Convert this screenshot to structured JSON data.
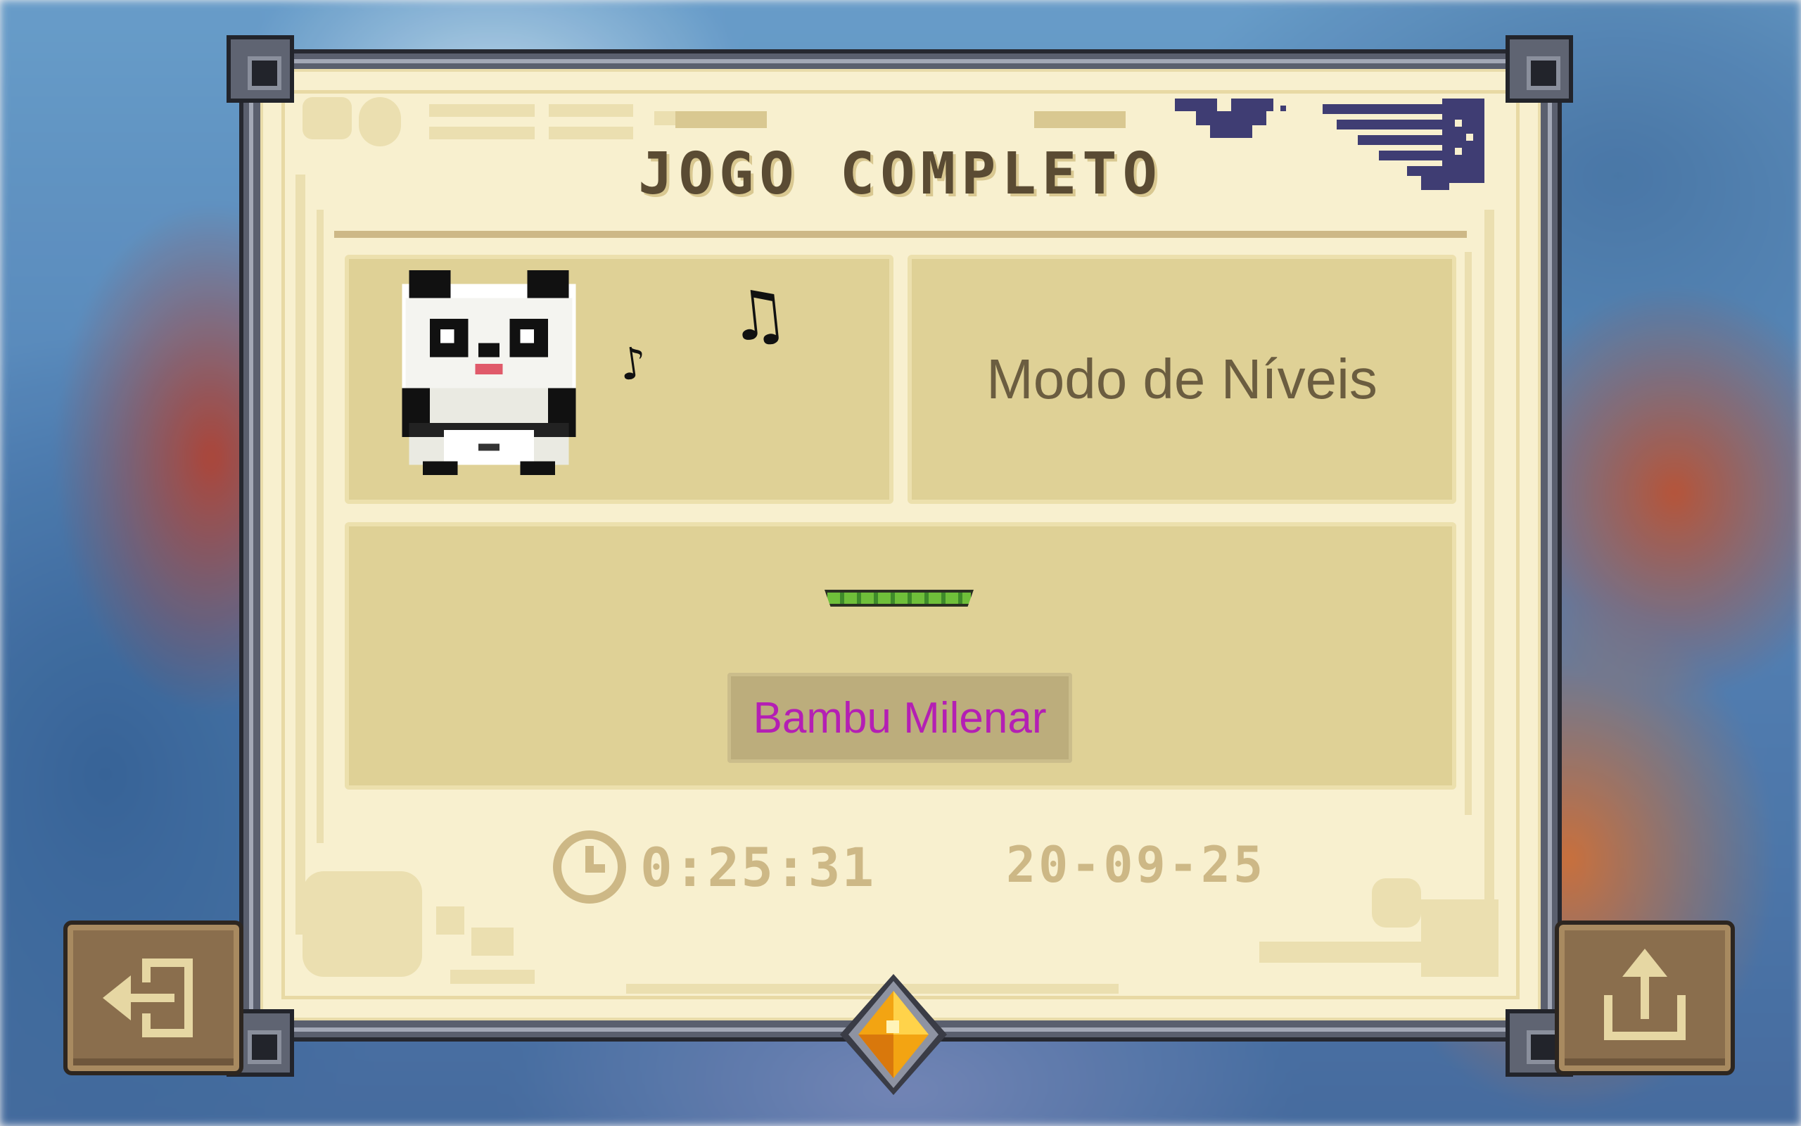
{
  "screen": {
    "title": "JOGO COMPLETO",
    "mode_label": "Modo de Níveis",
    "character": {
      "name": "Bambu Milenar",
      "icon": "panda-icon",
      "name_color": "#b41fb4"
    },
    "decorations": {
      "note_small": "♪",
      "note_large": "♫"
    },
    "progress": {
      "value": 1.0
    },
    "stats": {
      "time": "0:25:31",
      "date": "20-09-25"
    }
  },
  "buttons": {
    "exit": {
      "icon": "exit-icon"
    },
    "share": {
      "icon": "share-icon"
    }
  },
  "colors": {
    "paper": "#f8f0cf",
    "card": "#dfd196",
    "title": "#5a4b33",
    "stats_text": "#cdb886",
    "button_brown": "#8a6e4d",
    "frame": "#5a5f6e",
    "gem": "#f3a412"
  }
}
